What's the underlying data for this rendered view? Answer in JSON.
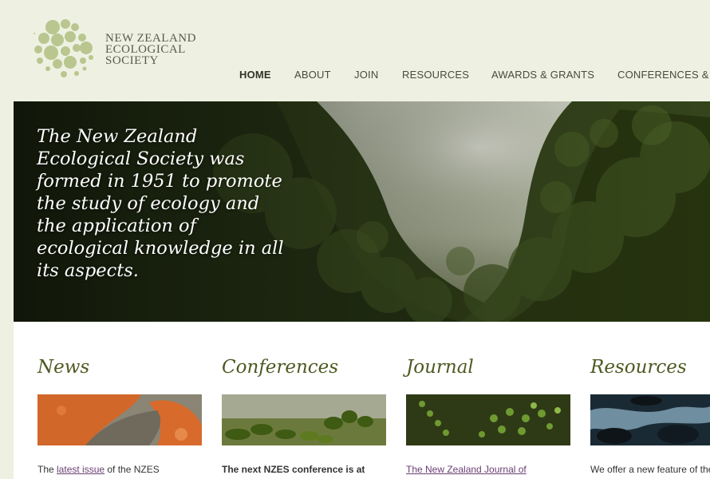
{
  "logo": {
    "line1": "NEW ZEALAND",
    "line2": "ECOLOGICAL",
    "line3": "SOCIETY",
    "icon": "dot-cluster-logo"
  },
  "nav": {
    "items": [
      {
        "label": "HOME"
      },
      {
        "label": "ABOUT"
      },
      {
        "label": "JOIN"
      },
      {
        "label": "RESOURCES"
      },
      {
        "label": "AWARDS & GRANTS"
      },
      {
        "label": "CONFERENCES &"
      }
    ]
  },
  "hero": {
    "text": "The New Zealand Ecological Society was formed in 1951 to promote the study of ecology and the application of ecological knowledge in all its aspects."
  },
  "sections": {
    "news": {
      "title": "News",
      "blurb_pre": "The ",
      "blurb_link": "latest issue",
      "blurb_post": " of the NZES"
    },
    "conferences": {
      "title": "Conferences",
      "blurb": "The next NZES conference is at"
    },
    "journal": {
      "title": "Journal",
      "blurb_link": "The New Zealand Journal of"
    },
    "resources": {
      "title": "Resources",
      "blurb": "We offer a new feature of the"
    }
  },
  "colors": {
    "background": "#eef1e2",
    "heading": "#4d5a22",
    "link": "#6a3e73",
    "logo_green": "#b7c48c"
  }
}
